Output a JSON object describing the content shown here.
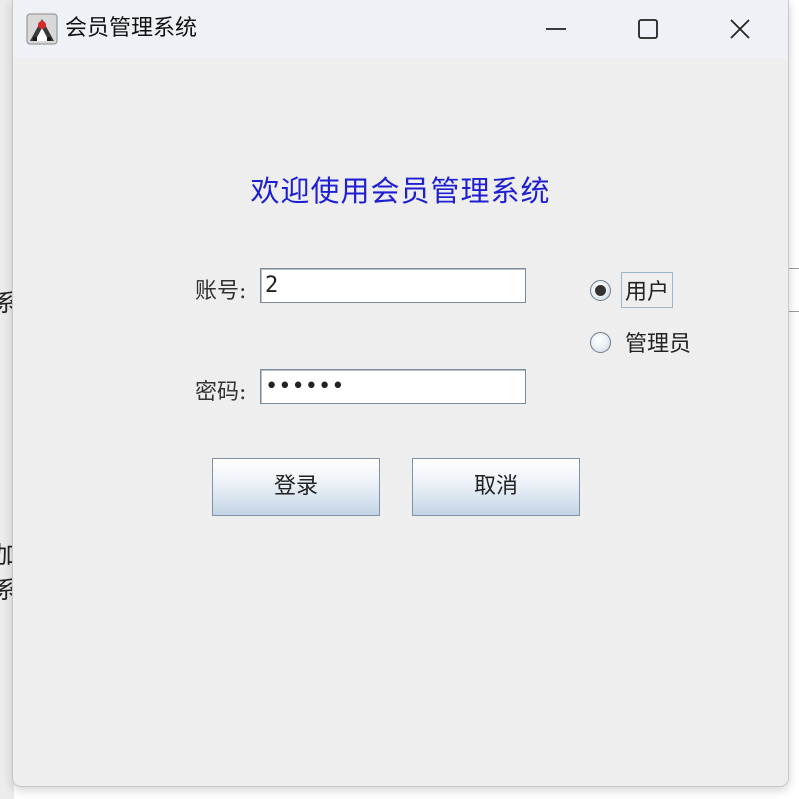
{
  "window": {
    "title": "会员管理系统",
    "controls": [
      "minimize-icon",
      "maximize-icon",
      "close-icon"
    ]
  },
  "background": {
    "partial_text_1": "系",
    "partial_text_2": "加系"
  },
  "form": {
    "welcome": "欢迎使用会员管理系统",
    "account_label": "账号:",
    "account_value": "2",
    "password_label": "密码:",
    "password_value": "••••••",
    "role_options": [
      {
        "label": "用户",
        "selected": true
      },
      {
        "label": "管理员",
        "selected": false
      }
    ],
    "login_label": "登录",
    "cancel_label": "取消"
  },
  "colors": {
    "welcome": "#1f1fd2",
    "background": "#eeeeee"
  }
}
